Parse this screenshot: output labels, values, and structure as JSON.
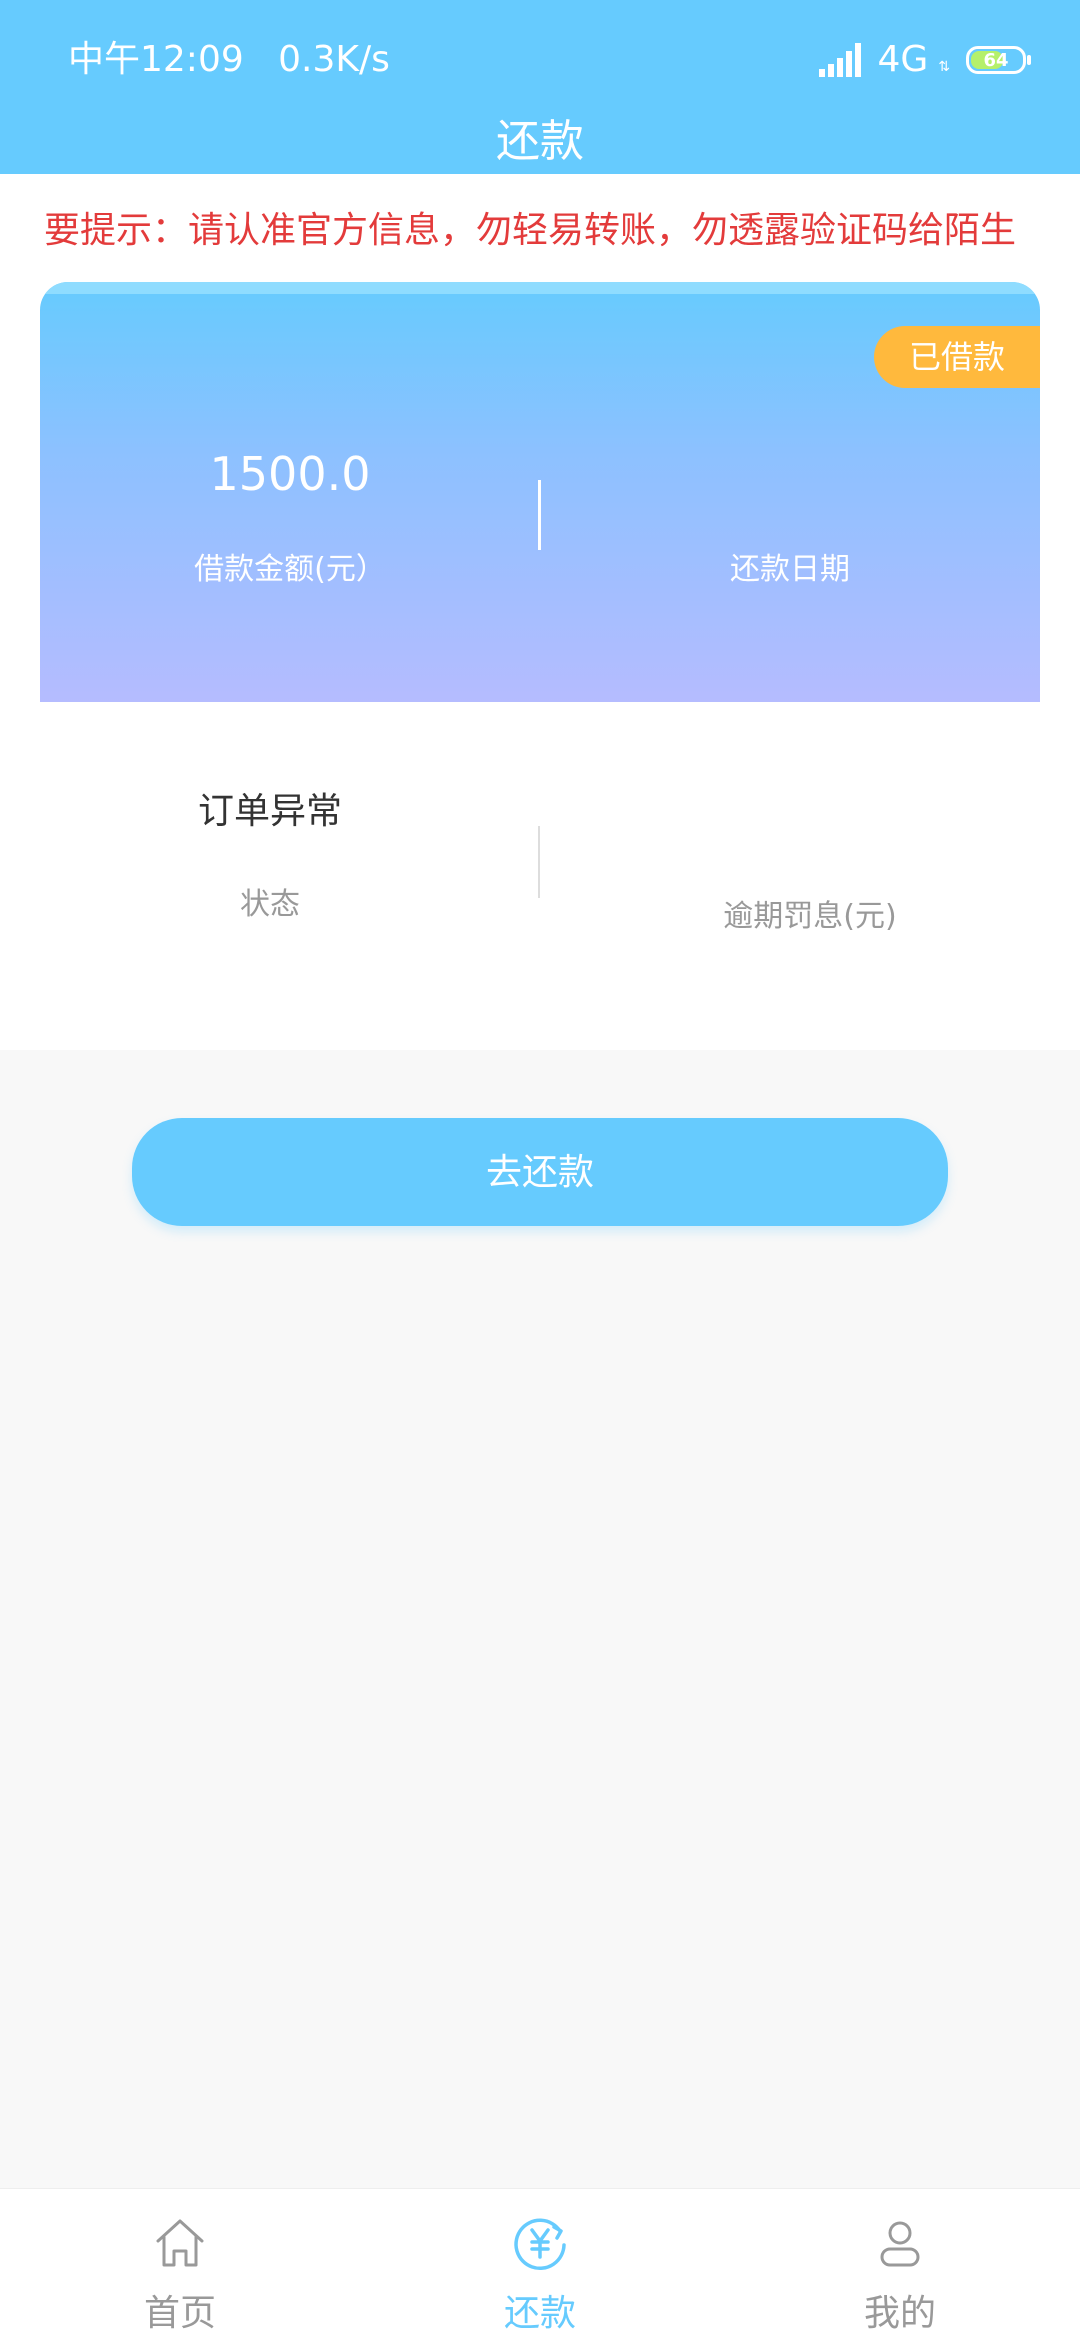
{
  "status_bar": {
    "time": "中午12:09",
    "net_speed": "0.3K/s",
    "network": "4G",
    "battery": "64"
  },
  "header": {
    "title": "还款"
  },
  "notice": {
    "text": "要提示：请认准官方信息，勿轻易转账，勿透露验证码给陌生"
  },
  "loan_card": {
    "status_badge": "已借款",
    "amount": "1500.0",
    "amount_label": "借款金额(元）",
    "repay_date_label": "还款日期"
  },
  "details": {
    "order_status": "订单异常",
    "order_status_label": "状态",
    "overdue_label": "逾期罚息(元)"
  },
  "repay_button": {
    "label": "去还款"
  },
  "tabbar": {
    "items": [
      {
        "label": "首页",
        "icon": "home-icon",
        "active": false
      },
      {
        "label": "还款",
        "icon": "repay-yuan-icon",
        "active": true
      },
      {
        "label": "我的",
        "icon": "profile-icon",
        "active": false
      }
    ]
  },
  "colors": {
    "primary": "#66cbfe",
    "badge": "#ffb93d",
    "notice_text": "#e33b3b"
  }
}
